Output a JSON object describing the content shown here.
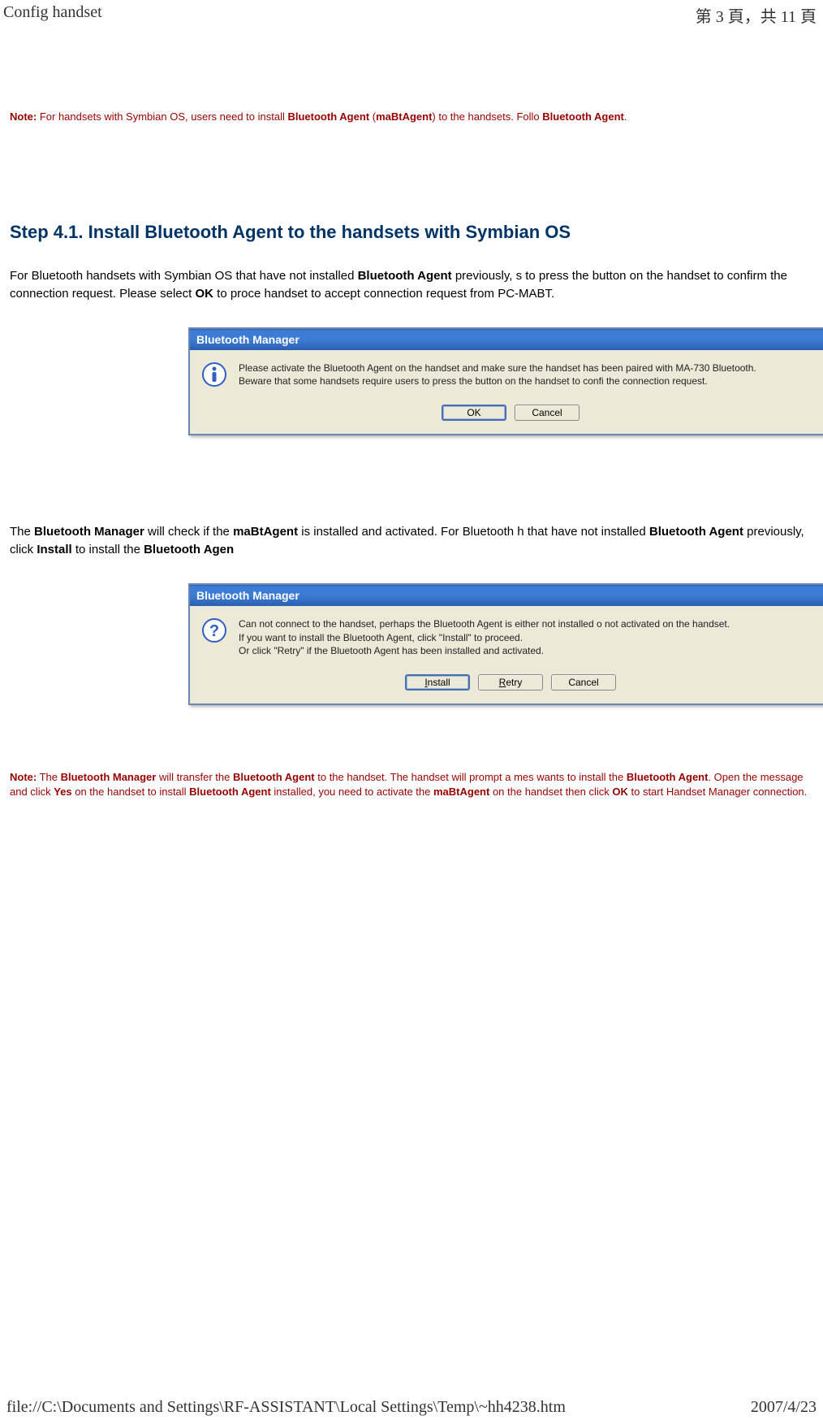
{
  "header": {
    "left": "Config handset",
    "right": "第 3 頁，共 11 頁"
  },
  "note1_plain": "Note: For handsets with Symbian OS, users need to install Bluetooth Agent (maBtAgent) to the handsets. Follo Bluetooth Agent.",
  "note1": {
    "prefix": "Note:",
    "t1": " For handsets with Symbian OS, users need to install ",
    "b1": "Bluetooth Agent",
    "t2": " (",
    "b2": "maBtAgent",
    "t3": ") to the handsets. Follo ",
    "b3": "Bluetooth Agent",
    "t4": "."
  },
  "step_title": "Step 4.1. Install Bluetooth Agent to the handsets with Symbian OS",
  "para1": {
    "t1": "For Bluetooth handsets with Symbian OS that have not installed ",
    "b1": "Bluetooth Agent",
    "t2": " previously, s to press the button on the handset to confirm the connection request. Please select ",
    "b2": "OK",
    "t3": " to proce handset to accept connection request from PC-MABT."
  },
  "dialog1": {
    "title": "Bluetooth Manager",
    "line1": "Please activate the Bluetooth Agent on the handset and make sure the handset has been paired with MA-730 Bluetooth.",
    "line2": "Beware that some handsets require users to press the button on the handset to confi the connection request.",
    "ok": "OK",
    "cancel": "Cancel"
  },
  "para2": {
    "t1": "The ",
    "b1": "Bluetooth Manager",
    "t2": " will check if the ",
    "b2": "maBtAgent",
    "t3": " is installed and activated. For Bluetooth h that have not installed ",
    "b3": "Bluetooth Agent",
    "t4": " previously, click ",
    "b4": "Install",
    "t5": " to install the ",
    "b5": "Bluetooth Agen"
  },
  "dialog2": {
    "title": "Bluetooth Manager",
    "line1": "Can not connect to the handset, perhaps the Bluetooth Agent is either not installed o not activated on the handset.",
    "line2": "If you want to install the Bluetooth Agent, click \"Install\" to proceed.",
    "line3": "Or click \"Retry\" if the Bluetooth Agent has been installed and activated.",
    "install_u": "I",
    "install_rest": "nstall",
    "retry_u": "R",
    "retry_rest": "etry",
    "cancel": "Cancel"
  },
  "note2": {
    "prefix": "Note:",
    "t1": " The ",
    "b1": "Bluetooth Manager",
    "t2": " will transfer the ",
    "b2": "Bluetooth Agent",
    "t3": " to the handset. The handset will prompt a mes wants to install the ",
    "b3": "Bluetooth Agent",
    "t4": ". Open the message and click ",
    "b4": "Yes",
    "t5": " on the handset to install ",
    "b5": "Bluetooth Agent",
    "t6": " installed, you need to activate the ",
    "b6": "maBtAgent",
    "t7": " on the handset then click ",
    "b7": "OK",
    "t8": " to start Handset Manager connection."
  },
  "footer": {
    "left": "file://C:\\Documents and Settings\\RF-ASSISTANT\\Local Settings\\Temp\\~hh4238.htm",
    "right": "2007/4/23"
  }
}
